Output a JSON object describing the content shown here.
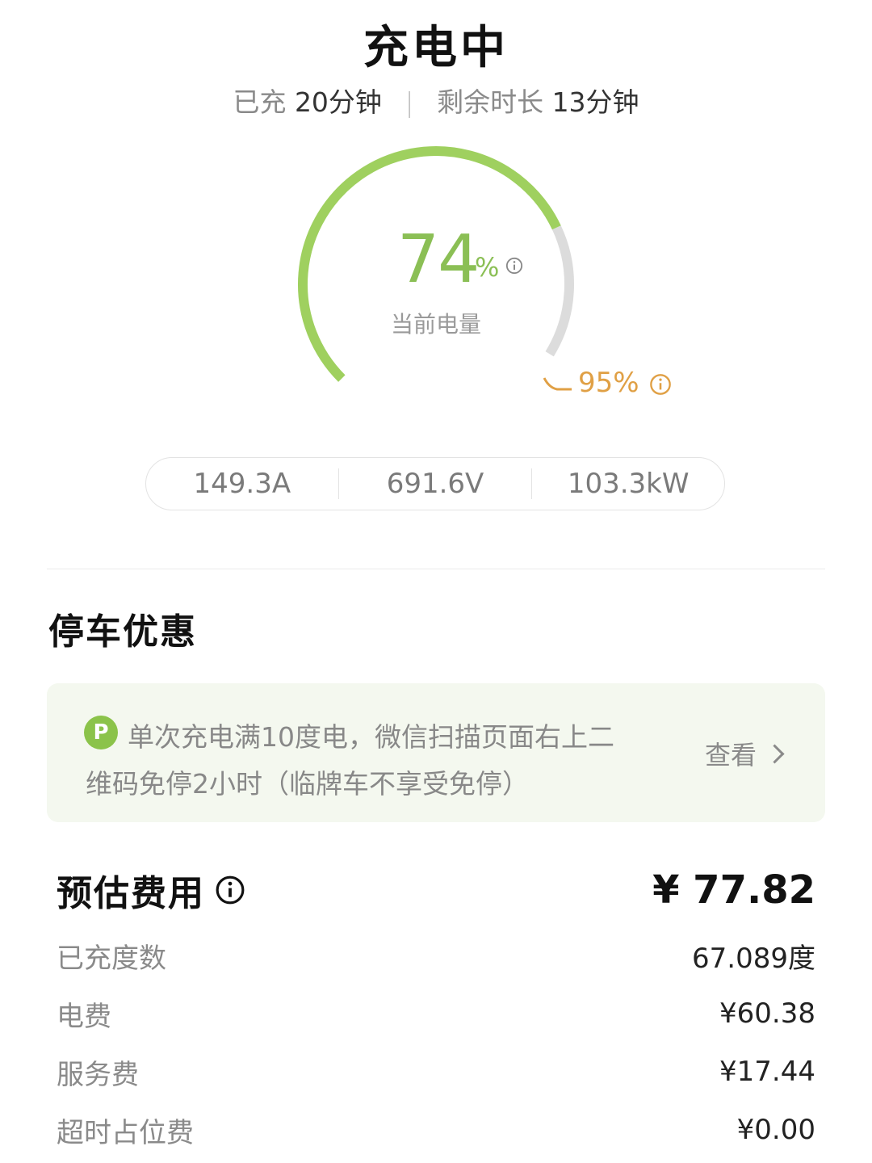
{
  "header": {
    "title": "充电中",
    "charged_label": "已充",
    "charged_value": "20分钟",
    "remaining_label": "剩余时长",
    "remaining_value": "13分钟"
  },
  "gauge": {
    "current_percent": 74,
    "percent_display": "74",
    "percent_unit": "%",
    "current_label": "当前电量",
    "target_percent": 95,
    "target_display": "95%",
    "colors": {
      "progress": "#9fd05f",
      "track": "#dcdcdc",
      "target": "#e0a045"
    }
  },
  "metrics": {
    "current": "149.3A",
    "voltage": "691.6V",
    "power": "103.3kW"
  },
  "parking": {
    "section_title": "停车优惠",
    "icon_letter": "P",
    "line1": "单次充电满10度电，微信扫描页面右上二",
    "line2": "维码免停2小时（临牌车不享受免停）",
    "link_label": "查看"
  },
  "fees": {
    "title": "预估费用",
    "total": "¥ 77.82",
    "rows": [
      {
        "label": "已充度数",
        "value": "67.089度"
      },
      {
        "label": "电费",
        "value": "¥60.38"
      },
      {
        "label": "服务费",
        "value": "¥17.44"
      },
      {
        "label": "超时占位费",
        "value": "¥0.00"
      }
    ]
  },
  "icons": {
    "info": "info-icon",
    "chevron": "chevron-right-icon",
    "parking": "parking-icon"
  }
}
